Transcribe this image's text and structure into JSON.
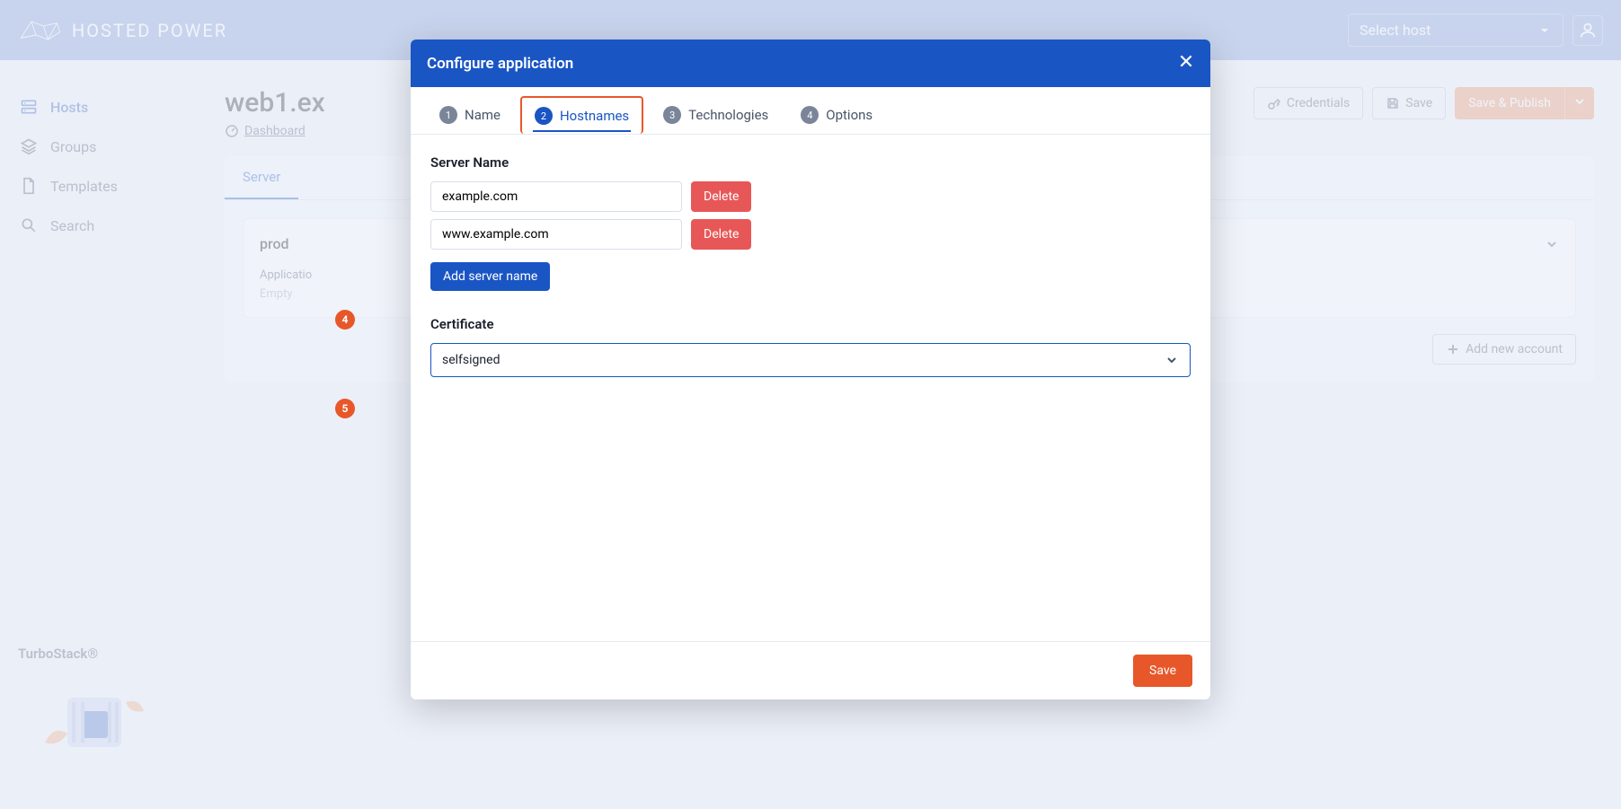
{
  "header": {
    "brand_text": "HOSTED POWER",
    "host_select_placeholder": "Select host"
  },
  "sidebar": {
    "items": [
      {
        "label": "Hosts"
      },
      {
        "label": "Groups"
      },
      {
        "label": "Templates"
      },
      {
        "label": "Search"
      }
    ],
    "footer_label": "TurboStack®"
  },
  "page": {
    "title": "web1.ex",
    "breadcrumb": {
      "dashboard": "Dashboard"
    },
    "actions": {
      "credentials": "Credentials",
      "save": "Save",
      "save_publish": "Save & Publish"
    },
    "tabs": {
      "server": "Server"
    },
    "accordion": {
      "title": "prod",
      "app_label": "Applicatio",
      "empty": "Empty"
    },
    "add_account": "Add new account"
  },
  "modal": {
    "title": "Configure application",
    "tabs": [
      {
        "num": "1",
        "label": "Name"
      },
      {
        "num": "2",
        "label": "Hostnames"
      },
      {
        "num": "3",
        "label": "Technologies"
      },
      {
        "num": "4",
        "label": "Options"
      }
    ],
    "server_name_label": "Server Name",
    "server_names": [
      "example.com",
      "www.example.com"
    ],
    "delete_label": "Delete",
    "add_server_label": "Add server name",
    "certificate_label": "Certificate",
    "certificate_value": "selfsigned",
    "save_label": "Save"
  },
  "annotations": {
    "marker4": "4",
    "marker5": "5"
  }
}
